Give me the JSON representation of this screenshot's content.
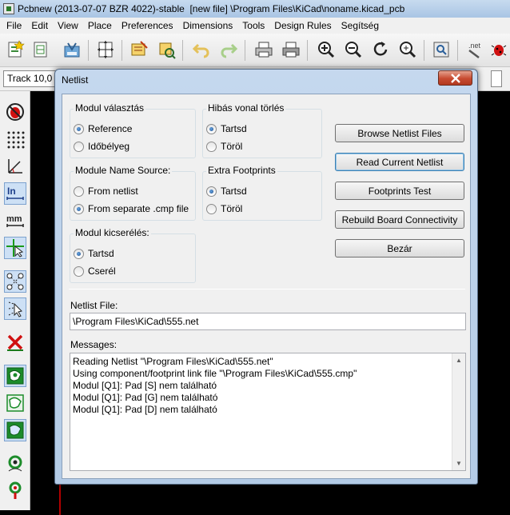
{
  "window": {
    "title": "Pcbnew (2013-07-07 BZR 4022)-stable  [new file] \\Program Files\\KiCad\\noname.kicad_pcb"
  },
  "menu": [
    "File",
    "Edit",
    "View",
    "Place",
    "Preferences",
    "Dimensions",
    "Tools",
    "Design Rules",
    "Segítség"
  ],
  "optbar": {
    "track_value": "Track 10,0"
  },
  "dialog": {
    "title": "Netlist",
    "groups": {
      "module_select": {
        "label": "Modul választás",
        "options": [
          {
            "label": "Reference",
            "checked": true
          },
          {
            "label": "Időbélyeg",
            "checked": false
          }
        ]
      },
      "bad_track": {
        "label": "Hibás vonal törlés",
        "options": [
          {
            "label": "Tartsd",
            "checked": true
          },
          {
            "label": "Töröl",
            "checked": false
          }
        ]
      },
      "module_name_source": {
        "label": "Module Name Source:",
        "options": [
          {
            "label": "From netlist",
            "checked": false
          },
          {
            "label": "From separate .cmp file",
            "checked": true
          }
        ]
      },
      "extra_footprints": {
        "label": "Extra Footprints",
        "options": [
          {
            "label": "Tartsd",
            "checked": true
          },
          {
            "label": "Töröl",
            "checked": false
          }
        ]
      },
      "module_exchange": {
        "label": "Modul kicserélés:",
        "options": [
          {
            "label": "Tartsd",
            "checked": true
          },
          {
            "label": "Cserél",
            "checked": false
          }
        ]
      }
    },
    "buttons": {
      "browse": "Browse Netlist Files",
      "read": "Read Current Netlist",
      "test": "Footprints Test",
      "rebuild": "Rebuild Board Connectivity",
      "close": "Bezár"
    },
    "netlist_file": {
      "label": "Netlist File:",
      "value": "\\Program Files\\KiCad\\555.net"
    },
    "messages": {
      "label": "Messages:",
      "lines": [
        "Reading Netlist \"\\Program Files\\KiCad\\555.net\"",
        "Using component/footprint link file \"\\Program Files\\KiCad\\555.cmp\"",
        "Modul [Q1]: Pad [S] nem található",
        "Modul [Q1]: Pad [G] nem található",
        "Modul [Q1]: Pad [D] nem található"
      ]
    }
  },
  "colors": {
    "canvas": "#000000",
    "dialog_frame": "#b3cbe6",
    "close_button": "#c74a30",
    "radio_dot": "#1c4f8f"
  },
  "icons": {
    "toolbar": [
      "new-board-icon",
      "open-icon",
      "save-icon",
      "page-settings-icon",
      "netlist-icon",
      "footprint-editor-icon",
      "undo-icon",
      "redo-icon",
      "print-icon",
      "plot-icon",
      "zoom-in-icon",
      "zoom-out-icon",
      "redraw-icon",
      "zoom-fit-icon",
      "find-icon",
      "netlist-read-icon",
      "drc-icon"
    ],
    "left_toolbar": [
      "drc-off-icon",
      "grid-icon",
      "polar-coords-icon",
      "inch-units-icon",
      "mm-units-icon",
      "cursor-shape-icon",
      "ratsnest-icon",
      "module-ratsnest-icon",
      "auto-delete-track-icon",
      "zone-fill-icon",
      "zone-outline-icon",
      "zone-sketch-icon",
      "show-vias-icon",
      "high-contrast-icon"
    ]
  }
}
